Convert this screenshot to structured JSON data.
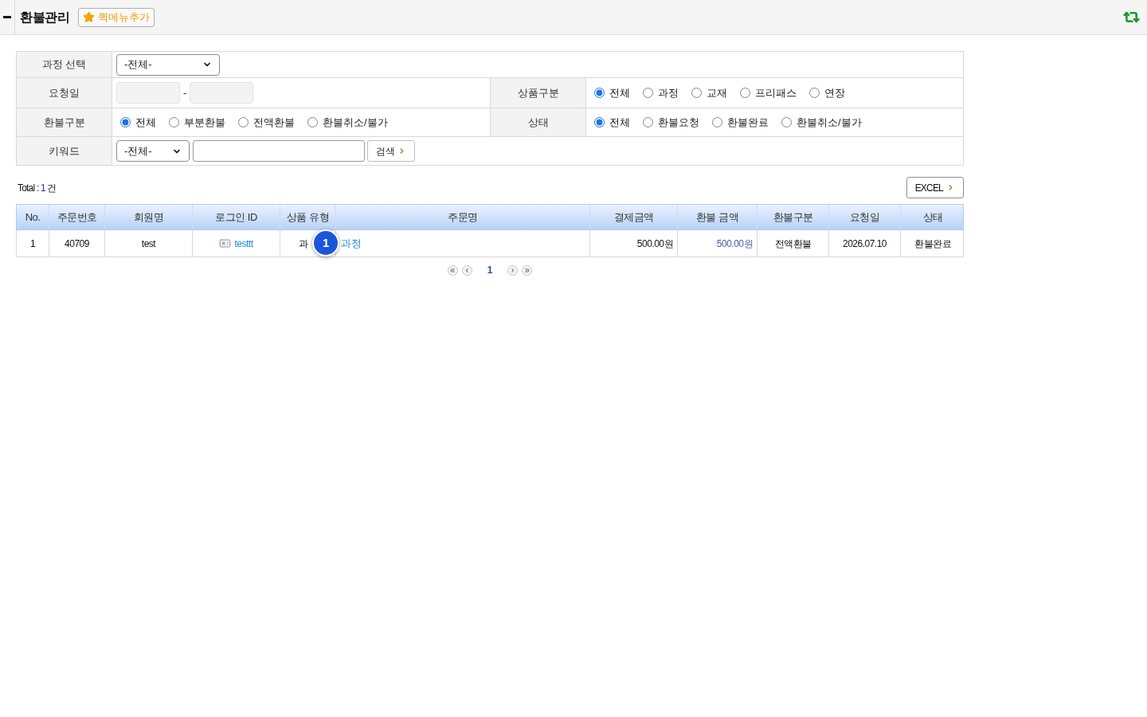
{
  "header": {
    "title": "환불관리",
    "quick_menu_button": "퀵메뉴추가"
  },
  "filters": {
    "course": {
      "label": "과정 선택",
      "value": "-전체-"
    },
    "request_date": {
      "label": "요청일",
      "separator": "-"
    },
    "product_type": {
      "label": "상품구분",
      "options": [
        {
          "label": "전체",
          "selected": true
        },
        {
          "label": "과정",
          "selected": false
        },
        {
          "label": "교재",
          "selected": false
        },
        {
          "label": "프리패스",
          "selected": false
        },
        {
          "label": "연장",
          "selected": false
        }
      ]
    },
    "refund_type": {
      "label": "환불구분",
      "options": [
        {
          "label": "전체",
          "selected": true
        },
        {
          "label": "부분환불",
          "selected": false
        },
        {
          "label": "전액환불",
          "selected": false
        },
        {
          "label": "환불취소/불가",
          "selected": false
        }
      ]
    },
    "status": {
      "label": "상태",
      "options": [
        {
          "label": "전체",
          "selected": true
        },
        {
          "label": "환불요청",
          "selected": false
        },
        {
          "label": "환불완료",
          "selected": false
        },
        {
          "label": "환불취소/불가",
          "selected": false
        }
      ]
    },
    "keyword": {
      "label": "키워드",
      "field_value": "-전체-",
      "search_button": "검색"
    }
  },
  "total": {
    "label": "Total :",
    "count": "1",
    "unit": "건"
  },
  "excel_button": "EXCEL",
  "table": {
    "columns": [
      "No.",
      "주문번호",
      "회원명",
      "로그인 ID",
      "상품 유형",
      "주문명",
      "결제금액",
      "환불 금액",
      "환불구분",
      "요청일",
      "상태"
    ],
    "rows": [
      {
        "cells": [
          {
            "kind": "plain",
            "text": "1"
          },
          {
            "kind": "plain",
            "text": "40709"
          },
          {
            "kind": "plain",
            "text": "test"
          },
          {
            "kind": "user_link",
            "text": "testtt"
          },
          {
            "kind": "plain",
            "text": "과",
            "marker": "1"
          },
          {
            "kind": "link",
            "text": "과정"
          },
          {
            "kind": "amount",
            "text": "500.00원"
          },
          {
            "kind": "refund_amount",
            "text": "500.00원"
          },
          {
            "kind": "plain",
            "text": "전액환불"
          },
          {
            "kind": "plain",
            "text": "2026.07.10"
          },
          {
            "kind": "plain",
            "text": "환불완료"
          }
        ]
      }
    ]
  },
  "pagination": {
    "pages": [
      {
        "label": "1",
        "selected": true
      }
    ]
  }
}
